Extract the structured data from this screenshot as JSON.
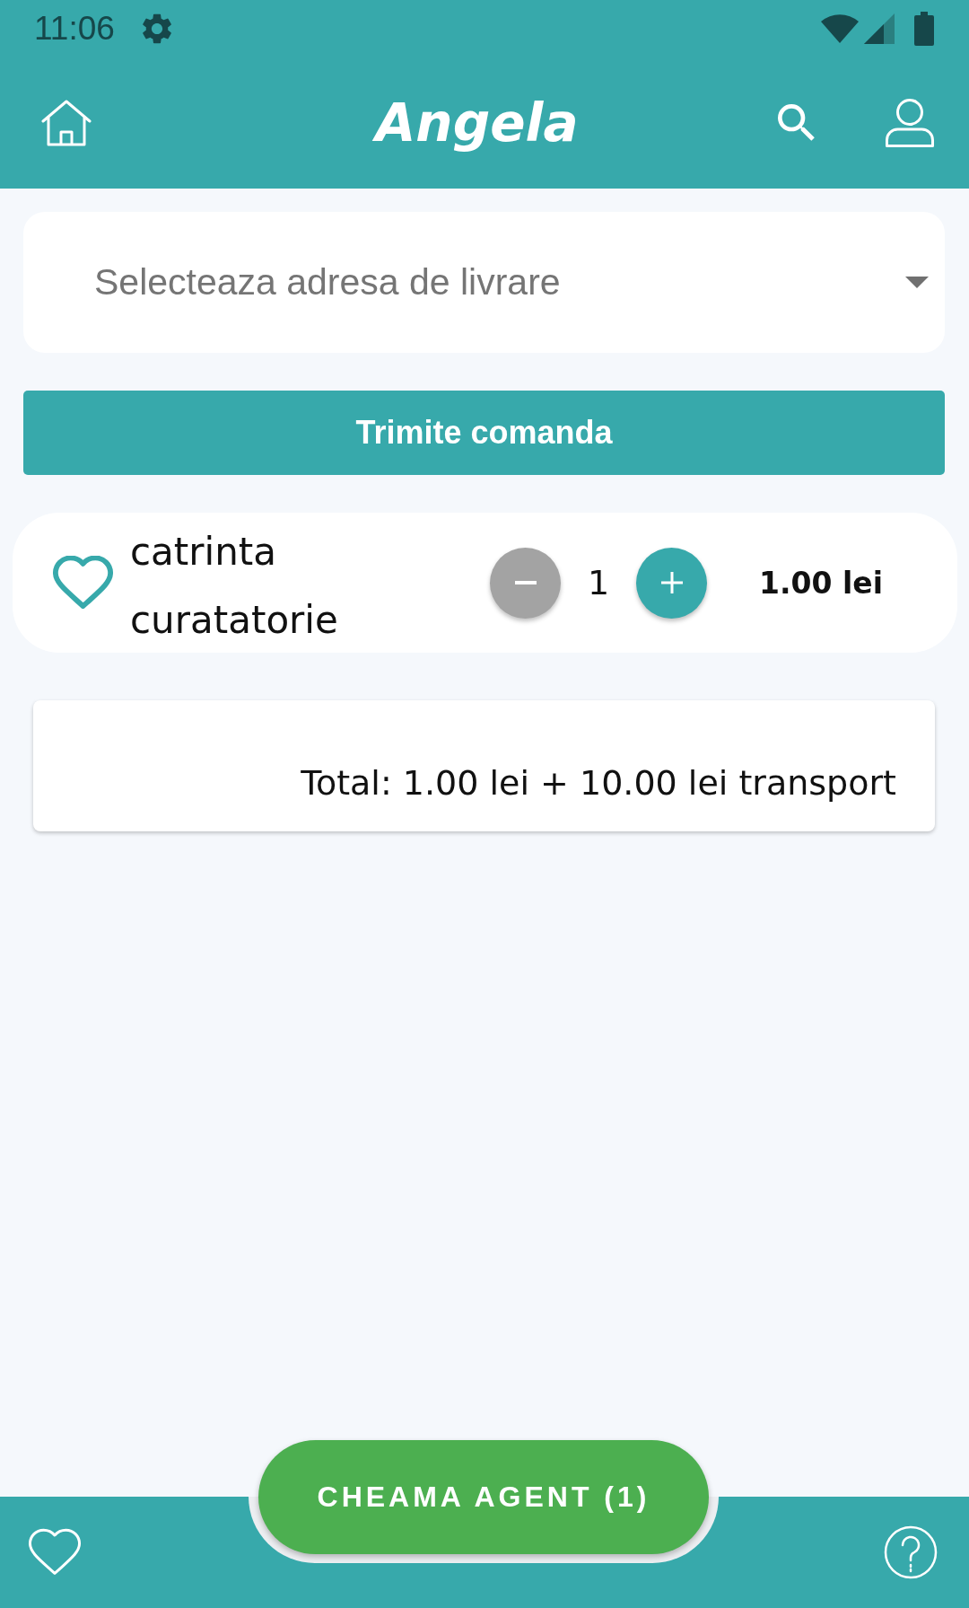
{
  "status_bar": {
    "time": "11:06"
  },
  "header": {
    "logo": "Angela"
  },
  "address_select": {
    "placeholder": "Selecteaza adresa de livrare"
  },
  "submit_button": {
    "label": "Trimite comanda"
  },
  "cart_items": [
    {
      "name": "catrinta curatatorie",
      "favorite": false,
      "decrease_disabled": true,
      "quantity": "1",
      "price": "1.00 lei"
    }
  ],
  "total": {
    "text": "Total: 1.00 lei + 10.00 lei transport"
  },
  "bottom_bar": {
    "agent_button": "CHEAMA AGENT (1)"
  }
}
